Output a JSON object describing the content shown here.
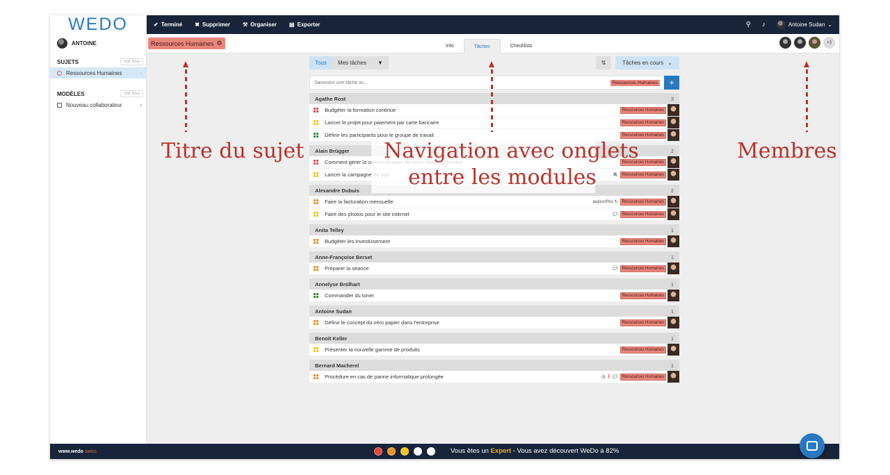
{
  "brand": "WEDO",
  "user": {
    "name": "ANTOINE",
    "topbar_name": "Antoine Sudan"
  },
  "sidebar": {
    "subjects_title": "SUJETS",
    "subjects_voir": "voir tous",
    "subjects": [
      {
        "label": "Ressources Humaines",
        "tail": "·"
      }
    ],
    "models_title": "MODÈLES",
    "models_voir": "voir tous",
    "models": [
      {
        "label": "Nouveau collaborateur",
        "tail": "‹"
      }
    ]
  },
  "topbar": {
    "done": "Terminé",
    "delete": "Supprimer",
    "organize": "Organiser",
    "export": "Exporter",
    "user_chevron": "⌄"
  },
  "subject": {
    "title": "Ressources Humaines"
  },
  "tabs": [
    {
      "label": "Info"
    },
    {
      "label": "Tâches"
    },
    {
      "label": "Checklists"
    }
  ],
  "members": {
    "more": "+3"
  },
  "filters": {
    "all": "Tous",
    "mine": "Mes tâches",
    "status": "Tâches en cours"
  },
  "search": {
    "placeholder": "Saisissez une tâche ici...",
    "tag": "Ressources Humaines",
    "add": "+"
  },
  "colors": {
    "accent": "#2a79c0",
    "navy": "#17243a",
    "tag": "#e9867c",
    "annotation": "#b8322a",
    "prio_red": "#d9534f",
    "prio_yellow": "#f5c518",
    "prio_green": "#3a8f3a",
    "prio_orange": "#f0902a"
  },
  "groups": [
    {
      "name": "Agathe Rost",
      "count": "3",
      "tasks": [
        {
          "text": "Budgéter la formation continue",
          "prio": "red",
          "meta": "",
          "tag": "Ressources Humaines"
        },
        {
          "text": "Lancer le projet pour paiement par carte bancaire",
          "prio": "yellow",
          "meta": "",
          "tag": "Ressources Humaines"
        },
        {
          "text": "Définir les participants pour le groupe de travail",
          "prio": "green",
          "meta": "",
          "tag": "Ressources Humaines"
        }
      ]
    },
    {
      "name": "Alain Brügger",
      "count": "2",
      "tasks": [
        {
          "text": "Comment gérer la communication de notre nouveau produit",
          "prio": "red",
          "meta": "",
          "tag": "Ressources Humaines"
        },
        {
          "text": "Lancer la campagne de pub",
          "prio": "yellow",
          "meta": "🖇",
          "tag": "Ressources Humaines"
        }
      ]
    },
    {
      "name": "Alexandre Dubuis",
      "count": "2",
      "tasks": [
        {
          "text": "Faire la facturation mensuelle",
          "prio": "orange",
          "meta": "aujourd'hui ↻",
          "tag": "Ressources Humaines"
        },
        {
          "text": "Faire des photos pour le site internet",
          "prio": "yellow",
          "meta": "💬",
          "tag": "Ressources Humaines"
        }
      ]
    },
    {
      "name": "Anita Telley",
      "count": "1",
      "tasks": [
        {
          "text": "Budgéter les investissement",
          "prio": "orange",
          "meta": "",
          "tag": "Ressources Humaines"
        }
      ]
    },
    {
      "name": "Anne-Françoise Berset",
      "count": "1",
      "tasks": [
        {
          "text": "Préparer la séance",
          "prio": "orange",
          "meta": "💬",
          "tag": "Ressources Humaines"
        }
      ]
    },
    {
      "name": "Annelyse Brülhart",
      "count": "1",
      "tasks": [
        {
          "text": "Commander du toner",
          "prio": "green",
          "meta": "",
          "tag": "Ressources Humaines"
        }
      ]
    },
    {
      "name": "Antoine Sudan",
      "count": "1",
      "tasks": [
        {
          "text": "Définir le concept du zéro papier dans l'entreprise",
          "prio": "orange",
          "meta": "",
          "tag": "Ressources Humaines"
        }
      ]
    },
    {
      "name": "Benoît Keller",
      "count": "1",
      "tasks": [
        {
          "text": "Présenter la nouvelle gamme de produits",
          "prio": "yellow",
          "meta": "",
          "tag": "Ressources Humaines"
        }
      ]
    },
    {
      "name": "Bernard Macherel",
      "count": "1",
      "tasks": [
        {
          "text": "Procédure en cas de panne informatique prolongée",
          "prio": "orange",
          "meta": "-1j ❗ 💬",
          "tag": "Ressources Humaines"
        }
      ]
    }
  ],
  "annotations": {
    "title": "Titre du sujet",
    "nav_line1": "Navigation avec onglets",
    "nav_line2": "entre les modules",
    "members": "Membres"
  },
  "footer": {
    "brand": "www.wedo",
    "brand_suffix": " swiss",
    "text_before": "Vous êtes un ",
    "text_level": "Expert",
    "text_after": " - Vous avez découvert WeDo à 82%"
  }
}
